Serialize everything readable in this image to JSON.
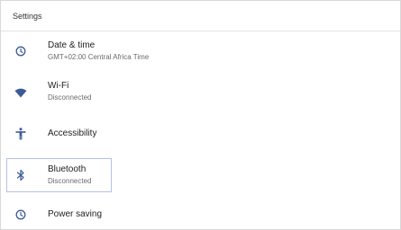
{
  "header": {
    "title": "Settings"
  },
  "items": [
    {
      "title": "Date & time",
      "subtitle": "GMT+02:00 Central Africa Time",
      "icon": "clock-icon"
    },
    {
      "title": "Wi-Fi",
      "subtitle": "Disconnected",
      "icon": "wifi-icon"
    },
    {
      "title": "Accessibility",
      "icon": "accessibility-icon"
    },
    {
      "title": "Bluetooth",
      "subtitle": "Disconnected",
      "icon": "bluetooth-icon"
    },
    {
      "title": "Power saving",
      "icon": "power-saving-icon"
    }
  ],
  "colors": {
    "icon": "#3c5a99",
    "selection_border": "#b6c0e6"
  }
}
